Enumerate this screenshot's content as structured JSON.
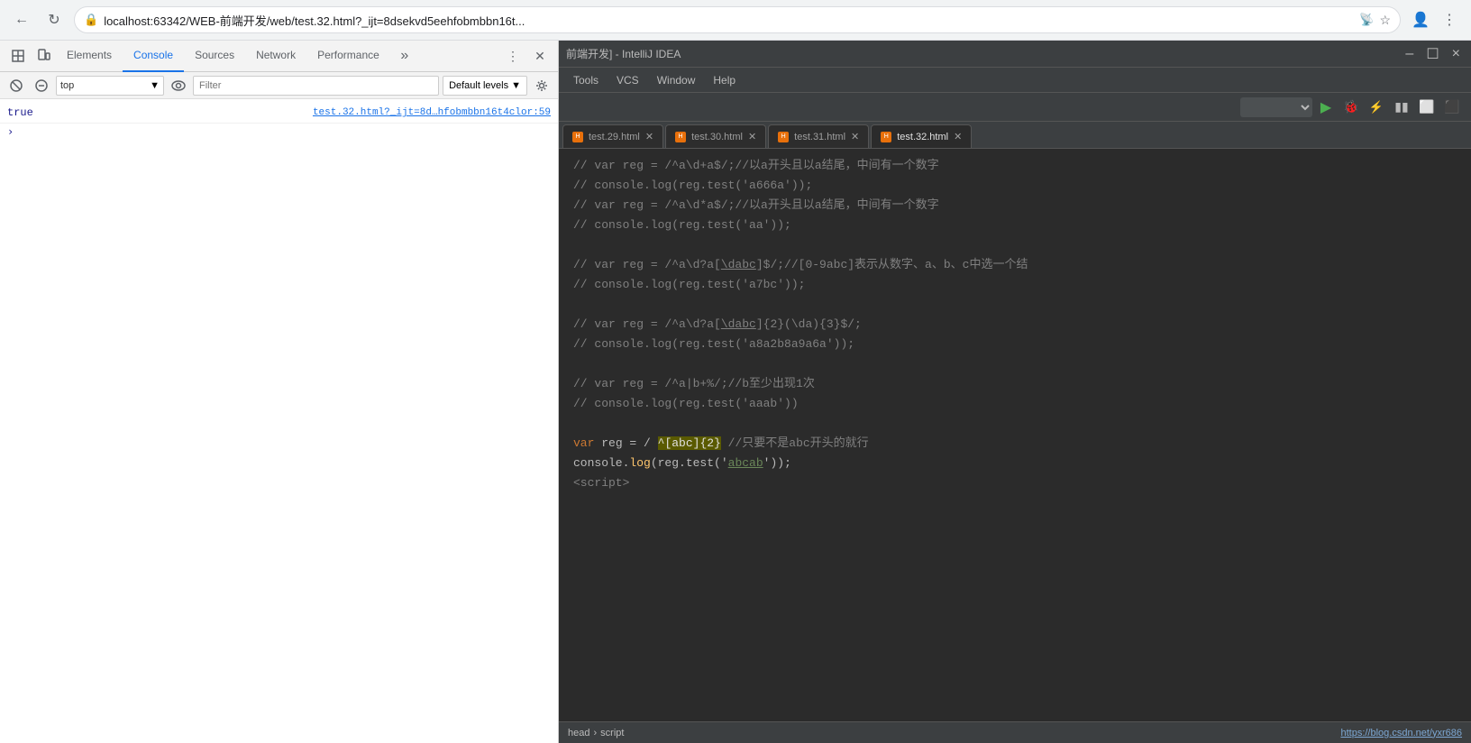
{
  "browser": {
    "address": "localhost:63342/WEB-前端开发/web/test.32.html?_ijt=8dsekvd5eehfobmbbn16t...",
    "lock_icon": "🔒"
  },
  "devtools": {
    "tabs": [
      {
        "label": "Elements",
        "active": false
      },
      {
        "label": "Console",
        "active": true
      },
      {
        "label": "Sources",
        "active": false
      },
      {
        "label": "Network",
        "active": false
      },
      {
        "label": "Performance",
        "active": false
      }
    ],
    "console": {
      "context": "top",
      "filter_placeholder": "Filter",
      "levels": "Default levels",
      "output": [
        {
          "value": "true",
          "source": "test.32.html?_ijt=8d…hfobmbbn16t4clor:59"
        }
      ]
    }
  },
  "ide": {
    "title": "前端开发] - IntelliJ IDEA",
    "menu_items": [
      "Tools",
      "VCS",
      "Window",
      "Help"
    ],
    "run_config": "",
    "tabs": [
      {
        "label": "test.29.html",
        "active": false
      },
      {
        "label": "test.30.html",
        "active": false
      },
      {
        "label": "test.31.html",
        "active": false
      },
      {
        "label": "test.32.html",
        "active": true
      }
    ],
    "code_lines": [
      {
        "type": "comment",
        "text": "// var reg = /^a\\d+a$/;//以a开头且以a结尾，中间有一个数字"
      },
      {
        "type": "comment",
        "text": "// console.log(reg.test('a666a'));"
      },
      {
        "type": "comment",
        "text": "// var reg = /^a\\d*a$/;//以a开头且以a结尾，中间有一个数字"
      },
      {
        "type": "comment",
        "text": "// console.log(reg.test('aa'));"
      },
      {
        "type": "empty"
      },
      {
        "type": "comment",
        "text": "// var reg = /^a\\d?a[\\dabc]$/;//[0-9abc]表示从数字、a、b、c中选一个结"
      },
      {
        "type": "comment",
        "text": "// console.log(reg.test('a7bc'));"
      },
      {
        "type": "empty"
      },
      {
        "type": "comment",
        "text": "// var reg = /^a\\d?a[\\dabc]{2}(\\da){3}$/;"
      },
      {
        "type": "comment",
        "text": "// console.log(reg.test('a8a2b8a9a6a'));"
      },
      {
        "type": "empty"
      },
      {
        "type": "comment",
        "text": "// var reg = /^a|b+%/;//b至少出现1次"
      },
      {
        "type": "comment",
        "text": "// console.log(reg.test('aaab'))"
      },
      {
        "type": "empty"
      },
      {
        "type": "code",
        "keyword": "var",
        "text": " reg = /",
        "regex_start": "^[abc]{2}",
        "regex_flag": "//只要不是abc开头的就行",
        "rest": ""
      },
      {
        "type": "code2",
        "text": "console.log(reg.test('",
        "string_val": "abcab",
        "rest": "'));"
      },
      {
        "type": "tag",
        "text": "<script>"
      }
    ],
    "statusbar": {
      "breadcrumb_head": "head",
      "breadcrumb_script": "script",
      "link": "https://blog.csdn.net/yxr686"
    }
  }
}
